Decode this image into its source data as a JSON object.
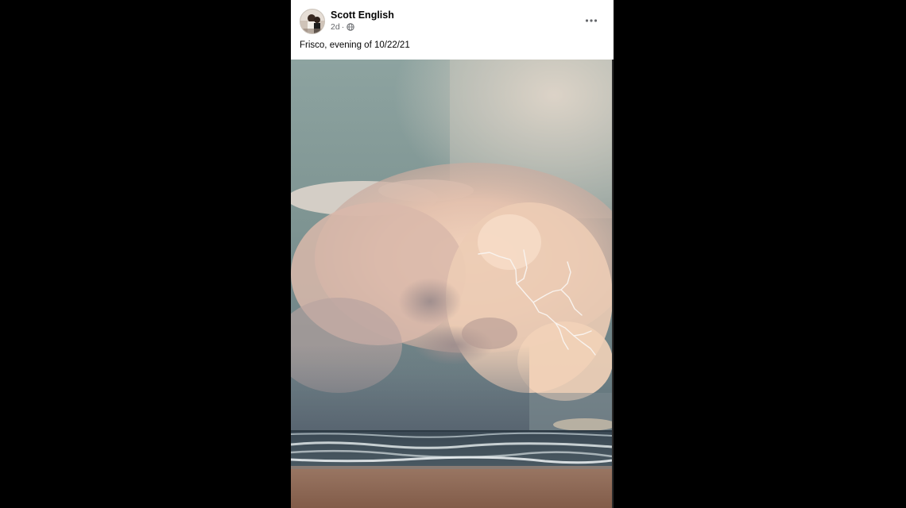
{
  "post": {
    "author": "Scott English",
    "time": "2d",
    "separator": "·",
    "privacy_icon": "globe-icon",
    "more_icon": "more-options-icon",
    "caption": "Frisco, evening of 10/22/21"
  },
  "photo": {
    "subject": "storm-cloud-lightning-over-ocean-beach"
  },
  "colors": {
    "page_background": "#000000",
    "card_background": "#ffffff",
    "name_text": "#050505",
    "meta_text": "#65676b",
    "sky": "#7f9693",
    "cloud": "#e8c9b4",
    "ocean": "#3b4b55",
    "sand": "#8f6a57"
  }
}
